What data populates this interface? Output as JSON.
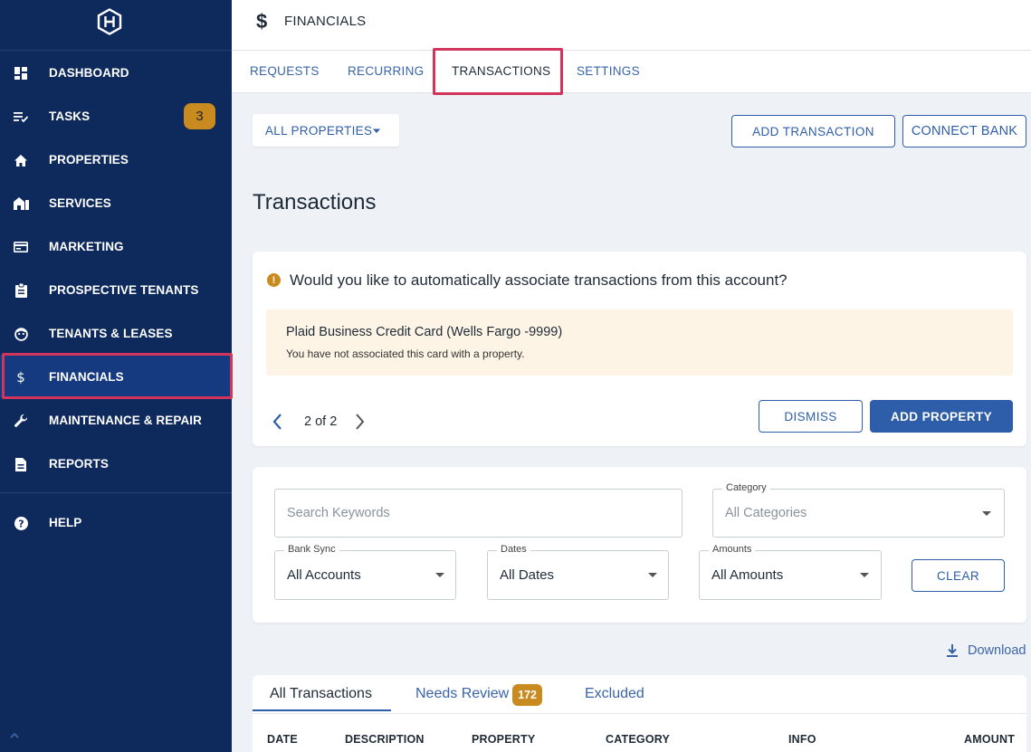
{
  "header": {
    "section_title": "FINANCIALS",
    "section_icon": "dollar-icon"
  },
  "top_tabs": [
    {
      "label": "REQUESTS"
    },
    {
      "label": "RECURRING"
    },
    {
      "label": "TRANSACTIONS",
      "active": true
    },
    {
      "label": "SETTINGS"
    }
  ],
  "sidebar": {
    "items": [
      {
        "label": "DASHBOARD",
        "icon": "dashboard-icon"
      },
      {
        "label": "TASKS",
        "icon": "tasks-icon",
        "badge": "3"
      },
      {
        "label": "PROPERTIES",
        "icon": "home-icon"
      },
      {
        "label": "SERVICES",
        "icon": "services-icon"
      },
      {
        "label": "MARKETING",
        "icon": "marketing-icon"
      },
      {
        "label": "PROSPECTIVE TENANTS",
        "icon": "clipboard-icon"
      },
      {
        "label": "TENANTS & LEASES",
        "icon": "tenant-icon"
      },
      {
        "label": "FINANCIALS",
        "icon": "dollar-icon",
        "active": true
      },
      {
        "label": "MAINTENANCE & REPAIR",
        "icon": "wrench-icon"
      },
      {
        "label": "REPORTS",
        "icon": "report-icon"
      },
      {
        "label": "HELP",
        "icon": "help-icon"
      }
    ]
  },
  "toolbar": {
    "property_filter": "ALL PROPERTIES",
    "add_transaction": "ADD TRANSACTION",
    "connect_bank": "CONNECT BANK"
  },
  "page_title": "Transactions",
  "association_card": {
    "question": "Would you like to automatically associate transactions from this account?",
    "account_name": "Plaid Business Credit Card (Wells Fargo -9999)",
    "account_note": "You have not associated this card with a property.",
    "pager": "2 of 2",
    "dismiss": "DISMISS",
    "add_property": "ADD PROPERTY"
  },
  "filters": {
    "search_placeholder": "Search Keywords",
    "category_label": "Category",
    "category_value": "All Categories",
    "bank_sync_label": "Bank Sync",
    "bank_sync_value": "All Accounts",
    "dates_label": "Dates",
    "dates_value": "All Dates",
    "amounts_label": "Amounts",
    "amounts_value": "All Amounts",
    "clear": "CLEAR"
  },
  "download_label": "Download",
  "table": {
    "tabs": [
      {
        "label": "All Transactions",
        "active": true
      },
      {
        "label": "Needs Review",
        "badge": "172"
      },
      {
        "label": "Excluded"
      }
    ],
    "columns": [
      "DATE",
      "DESCRIPTION",
      "PROPERTY",
      "CATEGORY",
      "INFO",
      "AMOUNT"
    ]
  },
  "colors": {
    "sidebar_bg": "#0e2a5c",
    "accent": "#2e5eaa",
    "badge": "#c98a1f",
    "highlight": "#d2345c"
  }
}
